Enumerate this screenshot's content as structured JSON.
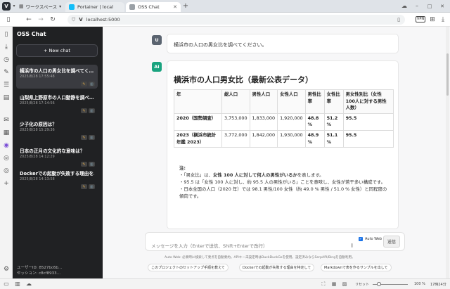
{
  "browser": {
    "workspaces_label": "ワークスペース",
    "tabs": [
      {
        "title": "Portainer | local",
        "active": false
      },
      {
        "title": "OSS Chat",
        "active": true
      }
    ],
    "new_tab_symbol": "+",
    "url": "localhost:5000",
    "vpn_badge": "VPN"
  },
  "sidebar": {
    "title": "OSS Chat",
    "new_chat_label": "+ New chat",
    "chats": [
      {
        "title": "横浜市の人口の男女比を調べてく…",
        "date": "2025/8/28 17:55:48",
        "active": true
      },
      {
        "title": "山梨県上野原市の人口動静を調べ…",
        "date": "2025/8/28 17:14:56",
        "active": false
      },
      {
        "title": "少子化の原因は？",
        "date": "2025/8/28 15:29:36",
        "active": false
      },
      {
        "title": "日本の正月の文化的な意味は？",
        "date": "2025/8/28 14:12:29",
        "active": false
      },
      {
        "title": "Dockerでの起動が失敗する理由を…",
        "date": "2025/8/28 14:13:58",
        "active": false
      }
    ],
    "footer_user": "ユーザーID: 8527bc6b…",
    "footer_session": "セッション: c8cf8933…"
  },
  "conversation": {
    "user_avatar": "U",
    "user_message": "横浜市の人口の男女比を調べてください。",
    "ai_avatar": "AI",
    "ai_heading": "横浜市の人口男女比（最新公表データ）",
    "table": {
      "headers": [
        "年",
        "総人口",
        "男性人口",
        "女性人口",
        "男性比率",
        "女性比率",
        "男女性別比（女性100人に対する男性人数）"
      ],
      "rows": [
        [
          "2020（国勢調査）",
          "3,753,000",
          "1,833,000",
          "1,920,000",
          "48.8 %",
          "51.2 %",
          "95.5"
        ],
        [
          "2023（横浜市統計年鑑 2023）",
          "3,772,000",
          "1,842,000",
          "1,930,000",
          "48.9 %",
          "51.1 %",
          "95.5"
        ]
      ]
    },
    "note": {
      "label": "注:",
      "line1_prefix": "・「男女比」は、",
      "line1_bold": "女性 100 人に対して何人の男性がいるか",
      "line1_suffix": "を表します。",
      "line2": "・95.5 は「女性 100 人に対し、約 95.5 人の男性がいる」ことを意味し、女性が若干多い構成です。",
      "line3": "・日本全国の人口（2020 年）では 98.1 男性/100 女性（約 49.0 % 男性 / 51.0 % 女性）と同程度の傾向です。"
    }
  },
  "composer": {
    "placeholder": "メッセージを入力（Enterで送信、Shift+Enterで改行）",
    "auto_web_label": "Auto Web",
    "auto_web_checked": true,
    "send_label": "送信",
    "hint": "Auto Web: 必要時に検索して要点を自動要約。APIキー未設定時はDuckDuckGoを使用。設定済みならSerpAPI/Bingを自動利用。",
    "suggestions": [
      "このプロジェクトのセットアップ手順を教えて",
      "Dockerでの起動が失敗する理由を特定して",
      "Markdownで表を作るサンプルを出して"
    ]
  },
  "statusbar": {
    "reset_label": "リセット",
    "zoom": "100 %",
    "time": "17時24分"
  },
  "colors": {
    "user_avatar": "#5b6470",
    "ai_avatar": "#19a37f",
    "sidebar_bg": "#202123"
  }
}
